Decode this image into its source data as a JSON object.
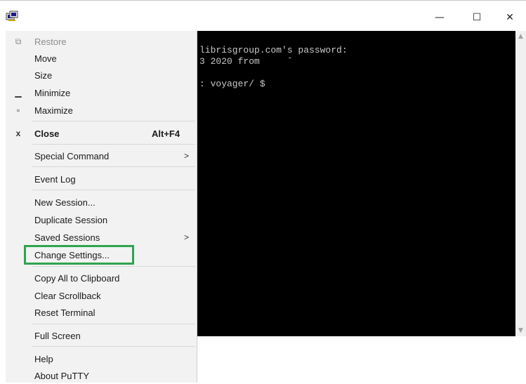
{
  "window": {
    "icon": "putty-icon",
    "controls": {
      "minimize": "—",
      "maximize": "☐",
      "close": "✕"
    }
  },
  "terminal": {
    "lines": [
      "librisgroup.com's password:",
      "3 2020 from     ˉ",
      "",
      ": voyager/ $"
    ],
    "background": "#000000",
    "foreground": "#c8c8c8"
  },
  "menu": {
    "restore": "Restore",
    "move": "Move",
    "size": "Size",
    "minimize": "Minimize",
    "maximize": "Maximize",
    "close": "Close",
    "close_accel": "Alt+F4",
    "special_command": "Special Command",
    "event_log": "Event Log",
    "new_session": "New Session...",
    "duplicate_session": "Duplicate Session",
    "saved_sessions": "Saved Sessions",
    "change_settings": "Change Settings...",
    "copy_all": "Copy All to Clipboard",
    "clear_scrollback": "Clear Scrollback",
    "reset_terminal": "Reset Terminal",
    "full_screen": "Full Screen",
    "help": "Help",
    "about": "About PuTTY",
    "submenu_arrow": ">",
    "highlight_color": "#2ea44f"
  }
}
